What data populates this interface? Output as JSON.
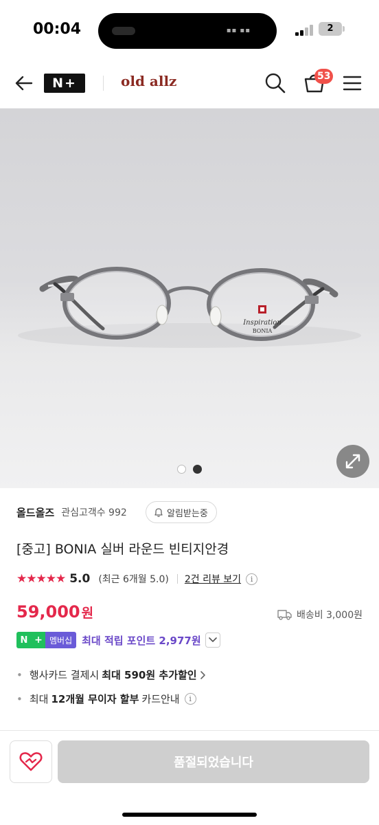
{
  "status": {
    "time": "00:04",
    "battery": "2"
  },
  "header": {
    "channel_badge": "N+",
    "brand_logo": "old allz",
    "cart_count": "53",
    "icons": [
      "back-arrow-icon",
      "search-icon",
      "cart-icon",
      "menu-icon"
    ]
  },
  "gallery": {
    "image_count": 2,
    "active_index": 2,
    "logo_text_1": "Inspiration",
    "logo_text_2": "BONIA"
  },
  "store": {
    "name": "올드올즈",
    "interest": "관심고객수 992",
    "alarm_label": "알림받는중"
  },
  "product": {
    "title": "[중고] BONIA 실버 라운드 빈티지안경",
    "stars": "★★★★★",
    "rating": "5.0",
    "recent_rating": "(최근 6개월 5.0)",
    "review_link": "2건 리뷰 보기",
    "price": "59,000",
    "currency": "원",
    "shipping": "배송비 3,000원"
  },
  "membership": {
    "badge_n": "N",
    "badge_plus": "+",
    "badge_label": "멤버십",
    "points_text": "최대 적립 포인트 2,977원"
  },
  "benefits": [
    {
      "pre": "행사카드 결제시",
      "bold": "최대 590원 추가할인",
      "post": ""
    },
    {
      "pre": "최대",
      "bold": "12개월 무이자 할부",
      "post": "카드안내"
    }
  ],
  "bottom": {
    "soldout_label": "품절되었습니다"
  },
  "colors": {
    "accent_red": "#e4284b",
    "points_purple": "#6a48c8",
    "naver_green": "#20c05c",
    "brand_maroon": "#8b2a22"
  }
}
